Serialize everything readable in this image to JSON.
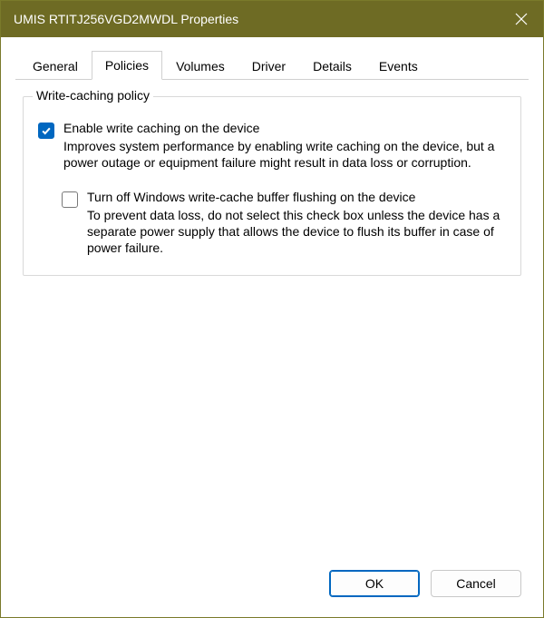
{
  "title": "UMIS RTITJ256VGD2MWDL Properties",
  "tabs": {
    "general": "General",
    "policies": "Policies",
    "volumes": "Volumes",
    "driver": "Driver",
    "details": "Details",
    "events": "Events"
  },
  "group": {
    "label": "Write-caching policy",
    "opt1": {
      "label": "Enable write caching on the device",
      "desc": "Improves system performance by enabling write caching on the device, but a power outage or equipment failure might result in data loss or corruption.",
      "checked": true
    },
    "opt2": {
      "label": "Turn off Windows write-cache buffer flushing on the device",
      "desc": "To prevent data loss, do not select this check box unless the device has a separate power supply that allows the device to flush its buffer in case of power failure.",
      "checked": false
    }
  },
  "buttons": {
    "ok": "OK",
    "cancel": "Cancel"
  }
}
